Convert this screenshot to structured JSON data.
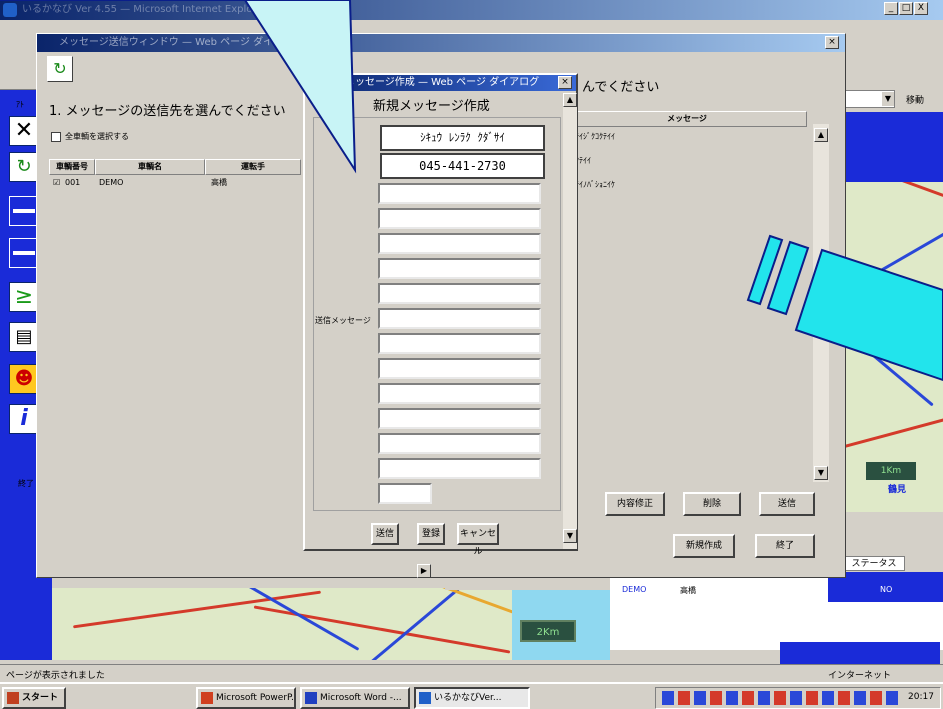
{
  "outer_window": {
    "title": "いるかなび Ver 4.55 — Microsoft Internet Explorer"
  },
  "top_right": {
    "min": "_",
    "max": "□",
    "close": "X"
  },
  "msg_selector": {
    "title": "メッセージ送信ウィンドウ — Web ページ ダイアログ",
    "prompt": "1. メッセージの送信先を選んでください",
    "select_all": "全車輌を選択する",
    "columns": [
      "車輌番号",
      "車輌名",
      "運転手"
    ],
    "rows": [
      {
        "checked": "☑",
        "number": "001",
        "name": "DEMO",
        "driver": "高橋"
      }
    ],
    "left_cut_label": "ｱﾄ",
    "side_number": "終了"
  },
  "right_panel": {
    "prompt_tail": "んでください",
    "column_header": "メッセージ",
    "messages": [
      "ｼﾃｲｼﾞｸｺｸﾃｲｲ",
      "ｺｸﾃｲｲ",
      "ｼﾃｲﾉﾊﾞｼｮﾆｲｹ"
    ],
    "buttons": {
      "edit": "内容修正",
      "delete": "削除",
      "send": "送信",
      "new": "新規作成",
      "close": "終了"
    },
    "goto_label": "移動"
  },
  "compose_dialog": {
    "title": "メッセージ作成 — Web ページ ダイアログ",
    "heading": "新規メッセージ作成",
    "line1": "ｼｷｭｳ ﾚﾝﾗｸ ｸﾀﾞｻｲ",
    "line2": "045-441-2730",
    "side_label": "送信メッセージ",
    "buttons": {
      "send": "送信",
      "save": "登録",
      "cancel": "キャンセル"
    }
  },
  "status_panel": {
    "status_header": "ステータス",
    "value": "NO",
    "car": "DEMO",
    "driver": "高橋"
  },
  "map": {
    "scale_left": "2Km",
    "scale_right": "1Km",
    "place": "鶴見"
  },
  "statusbar": {
    "text": "ページが表示されました",
    "zone": "インターネット"
  },
  "taskbar": {
    "start": "スタート",
    "buttons": [
      "Microsoft PowerP...",
      "Microsoft Word -...",
      "いるかなびVer..."
    ],
    "clock": "20:17"
  },
  "colors": {
    "callout": "#c8f4f6",
    "callout_stroke": "#0a1e8a",
    "cyan_bar": "#22e4ec",
    "map_bg": "#dfe9c8",
    "road_red": "#d43a2a",
    "road_blue": "#2a48d8"
  }
}
